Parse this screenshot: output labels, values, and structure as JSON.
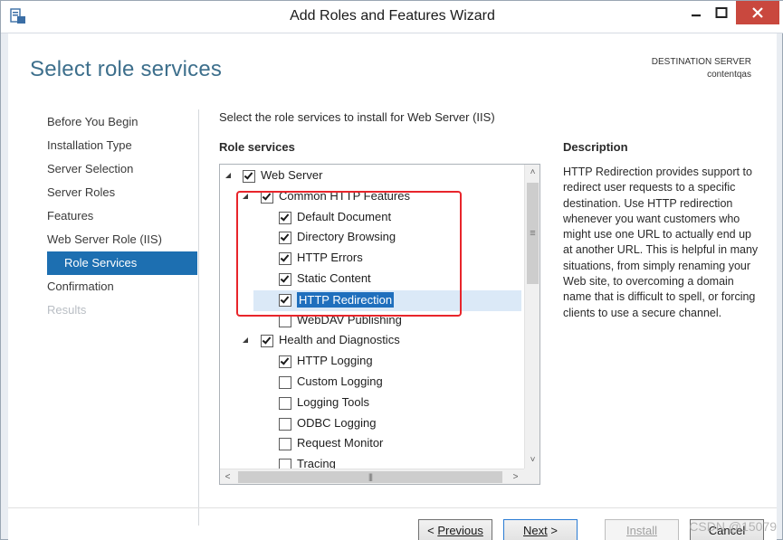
{
  "window": {
    "title": "Add Roles and Features Wizard",
    "controls": {
      "minimize": "—",
      "maximize": "▢",
      "close": "✕"
    }
  },
  "header": {
    "page_title": "Select role services",
    "destination_label": "DESTINATION SERVER",
    "destination_name": "contentqas"
  },
  "nav": {
    "items": [
      {
        "label": "Before You Begin",
        "state": "normal"
      },
      {
        "label": "Installation Type",
        "state": "normal"
      },
      {
        "label": "Server Selection",
        "state": "normal"
      },
      {
        "label": "Server Roles",
        "state": "normal"
      },
      {
        "label": "Features",
        "state": "normal"
      },
      {
        "label": "Web Server Role (IIS)",
        "state": "normal"
      },
      {
        "label": "Role Services",
        "state": "active"
      },
      {
        "label": "Confirmation",
        "state": "normal"
      },
      {
        "label": "Results",
        "state": "disabled"
      }
    ]
  },
  "main": {
    "instruction": "Select the role services to install for Web Server (IIS)",
    "role_services_header": "Role services",
    "tree": [
      {
        "label": "Web Server",
        "level": 0,
        "expandable": true,
        "checked": true
      },
      {
        "label": "Common HTTP Features",
        "level": 1,
        "expandable": true,
        "checked": true
      },
      {
        "label": "Default Document",
        "level": 2,
        "expandable": false,
        "checked": true
      },
      {
        "label": "Directory Browsing",
        "level": 2,
        "expandable": false,
        "checked": true
      },
      {
        "label": "HTTP Errors",
        "level": 2,
        "expandable": false,
        "checked": true
      },
      {
        "label": "Static Content",
        "level": 2,
        "expandable": false,
        "checked": true
      },
      {
        "label": "HTTP Redirection",
        "level": 2,
        "expandable": false,
        "checked": true,
        "selected": true
      },
      {
        "label": "WebDAV Publishing",
        "level": 2,
        "expandable": false,
        "checked": false
      },
      {
        "label": "Health and Diagnostics",
        "level": 1,
        "expandable": true,
        "checked": true
      },
      {
        "label": "HTTP Logging",
        "level": 2,
        "expandable": false,
        "checked": true
      },
      {
        "label": "Custom Logging",
        "level": 2,
        "expandable": false,
        "checked": false
      },
      {
        "label": "Logging Tools",
        "level": 2,
        "expandable": false,
        "checked": false
      },
      {
        "label": "ODBC Logging",
        "level": 2,
        "expandable": false,
        "checked": false
      },
      {
        "label": "Request Monitor",
        "level": 2,
        "expandable": false,
        "checked": false
      },
      {
        "label": "Tracing",
        "level": 2,
        "expandable": false,
        "checked": false
      }
    ],
    "scroll": {
      "up": "˄",
      "down": "˅",
      "left": "<",
      "right": ">",
      "grip_v": "≡",
      "grip_h": "|||"
    }
  },
  "description": {
    "header": "Description",
    "text": "HTTP Redirection provides support to redirect user requests to a specific destination. Use HTTP redirection whenever you want customers who might use one URL to actually end up at another URL. This is helpful in many situations, from simply renaming your Web site, to overcoming a domain name that is difficult to spell, or forcing clients to use a secure channel."
  },
  "buttons": {
    "previous_prefix": "< ",
    "previous": "Previous",
    "next": "Next",
    "next_suffix": " >",
    "install": "Install",
    "cancel": "Cancel"
  },
  "watermark": "CSDN @15079",
  "colors": {
    "accent": "#1d6fb1",
    "title": "#3d6f8c",
    "annotation": "#e8252b",
    "close_button": "#c9483e"
  }
}
